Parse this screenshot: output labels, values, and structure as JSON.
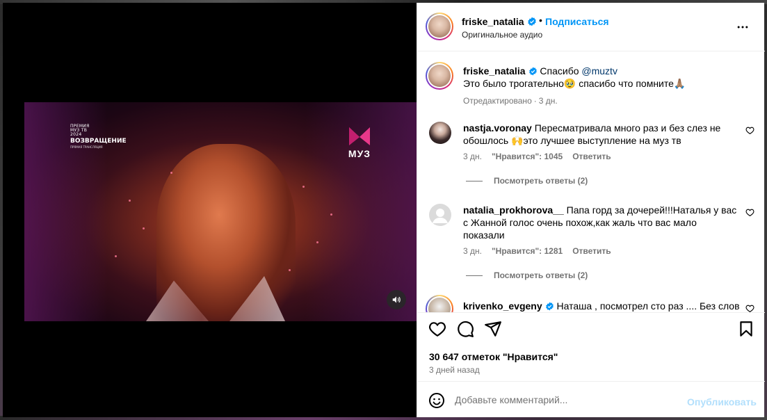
{
  "post": {
    "username": "friske_natalia",
    "follow_label": "Подписаться",
    "separator": "•",
    "audio": "Оригинальное аудио"
  },
  "video": {
    "overlay_line1": "ПРЕМИЯ",
    "overlay_line2": "МУЗ ТВ",
    "overlay_line3": "2024",
    "overlay_title": "ВОЗВРАЩЕНИЕ",
    "overlay_sub": "ПРЯМАЯ ТРАНСЛЯЦИЯ",
    "channel": "МУЗ"
  },
  "caption": {
    "username": "friske_natalia",
    "text_before_mention": "Спасибо ",
    "mention": "@muztv",
    "line2": "Это было трогательно🥹 спасибо что помните🙏🏽",
    "edited": "Отредактировано",
    "time": "3 дн."
  },
  "comments": [
    {
      "username": "nastja.voronay",
      "text": "Пересматривала много раз и без слез не обошлось 🙌это лучшее выступление на муз тв",
      "time": "3 дн.",
      "likes": "\"Нравится\": 1045",
      "reply": "Ответить",
      "view_replies": "Посмотреть ответы (2)"
    },
    {
      "username": "natalia_prokhorova__",
      "text": "Папа горд за дочерей!!!Наталья у вас с Жанной голос очень похож,как жаль что вас мало показали",
      "time": "3 дн.",
      "likes": "\"Нравится\": 1281",
      "reply": "Ответить",
      "view_replies": "Посмотреть ответы (2)"
    },
    {
      "username": "krivenko_evgeny",
      "text": "Наташа , посмотрел сто раз .... Без слов"
    }
  ],
  "footer": {
    "likes": "30 647 отметок \"Нравится\"",
    "date": "3 дней назад",
    "comment_placeholder": "Добавьте комментарий...",
    "publish": "Опубликовать"
  },
  "colors": {
    "accent": "#0095f6",
    "publish_disabled": "#b2dffc",
    "muted": "#737373"
  }
}
